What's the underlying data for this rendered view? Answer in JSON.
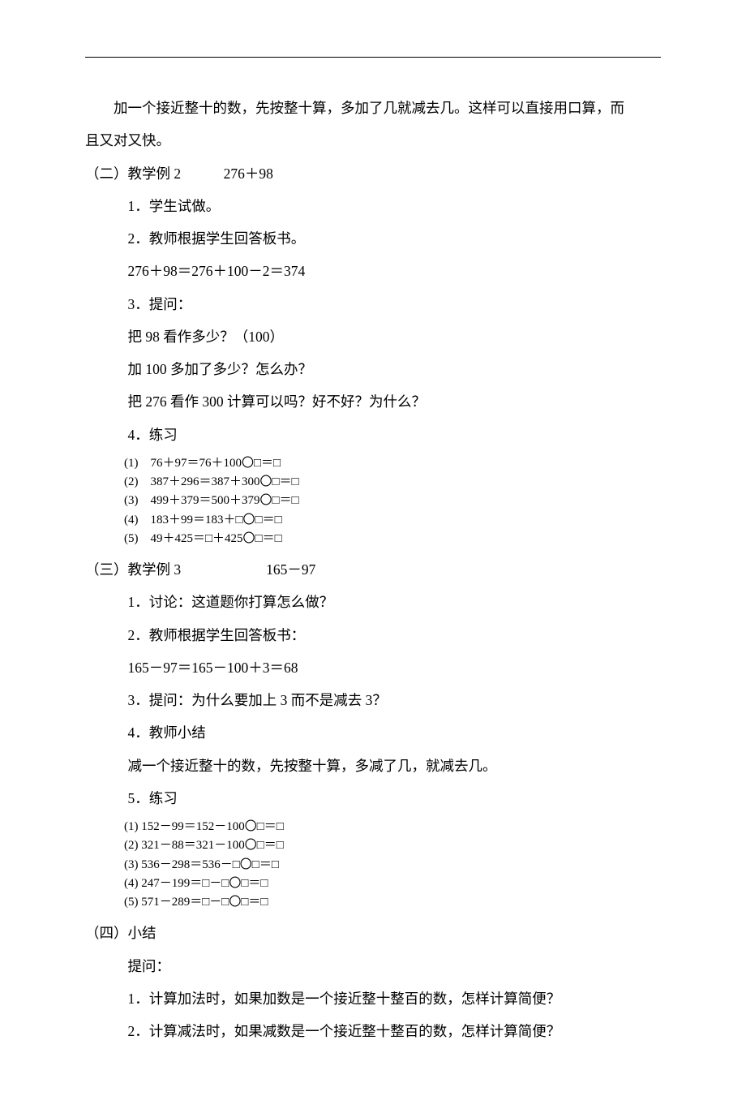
{
  "intro": {
    "line1": "加一个接近整十的数，先按整十算，多加了几就减去几。这样可以直接用口算，而",
    "line2": "且又对又快。"
  },
  "sec2": {
    "title_prefix": "（二）教学例 2",
    "title_expr": "276＋98",
    "i1": "1．学生试做。",
    "i2": "2．教师根据学生回答板书。",
    "eq": "276＋98＝276＋100－2＝374",
    "i3": "3．提问：",
    "q1": "把 98 看作多少？（100）",
    "q2": "加 100 多加了多少？怎么办？",
    "q3": "把 276 看作 300 计算可以吗？好不好？为什么？",
    "i4": "4．练习",
    "practice": [
      "(1)　76＋97＝76＋100〇□＝□",
      "(2)　387＋296＝387＋300〇□＝□",
      "(3)　499＋379＝500＋379〇□＝□",
      "(4)　183＋99＝183＋□〇□＝□",
      "(5)　49＋425＝□＋425〇□＝□"
    ]
  },
  "sec3": {
    "title_prefix": "（三）教学例 3",
    "title_expr": "165－97",
    "i1": "1．讨论：这道题你打算怎么做？",
    "i2": "2．教师根据学生回答板书：",
    "eq": "165－97＝165－100＋3＝68",
    "i3": "3．提问：为什么要加上 3 而不是减去 3？",
    "i4": "4．教师小结",
    "summary": "减一个接近整十的数，先按整十算，多减了几，就减去几。",
    "i5": "5．练习",
    "practice": [
      "(1) 152－99＝152－100〇□＝□",
      "(2) 321－88＝321－100〇□＝□",
      "(3) 536－298＝536－□〇□＝□",
      "(4) 247－199＝□－□〇□＝□",
      "(5) 571－289＝□－□〇□＝□"
    ]
  },
  "sec4": {
    "title": "（四）小结",
    "prompt": "提问：",
    "q1": "1．计算加法时，如果加数是一个接近整十整百的数，怎样计算简便？",
    "q2": "2．计算减法时，如果减数是一个接近整十整百的数，怎样计算简便？"
  }
}
